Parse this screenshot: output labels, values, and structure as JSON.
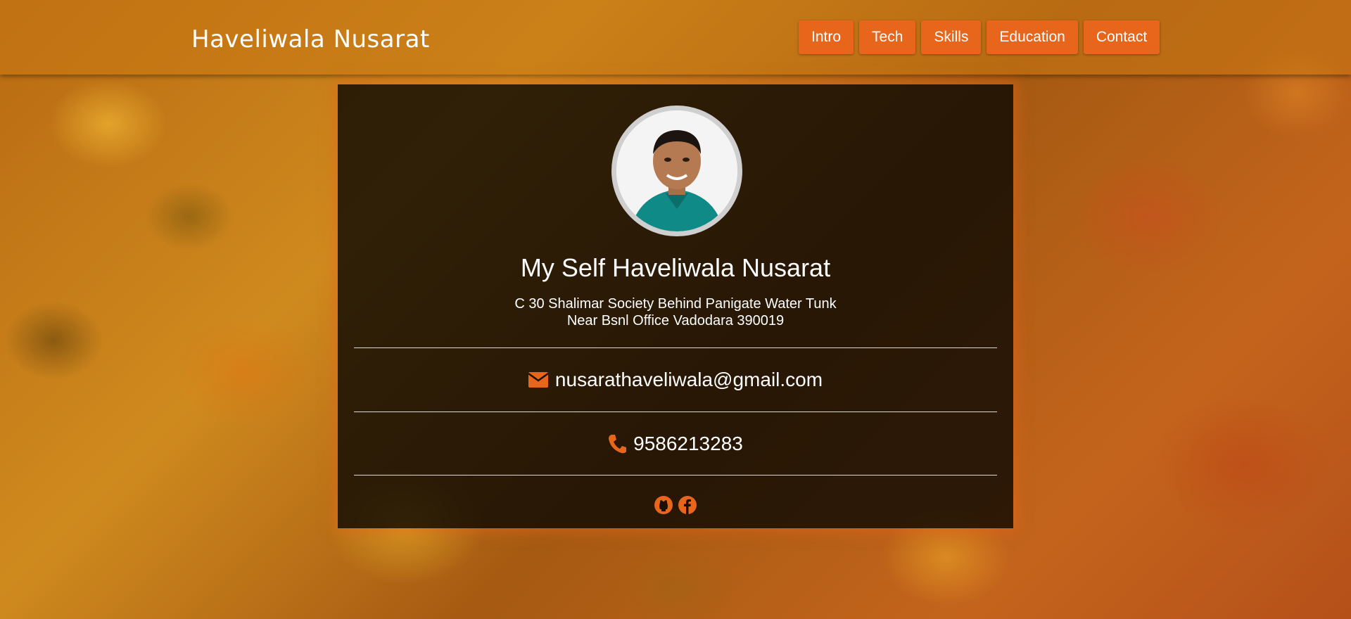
{
  "header": {
    "brand": "Haveliwala Nusarat",
    "nav": [
      {
        "label": "Intro"
      },
      {
        "label": "Tech"
      },
      {
        "label": "Skills"
      },
      {
        "label": "Education"
      },
      {
        "label": "Contact"
      }
    ]
  },
  "profile": {
    "avatar_icon": "profile-photo",
    "name": "My Self Haveliwala Nusarat",
    "address_line1": "C 30 Shalimar Society Behind Panigate Water Tunk",
    "address_line2": "Near Bsnl Office Vadodara 390019",
    "email": "nusarathaveliwala@gmail.com",
    "phone": "9586213283",
    "socials": [
      "github-icon",
      "facebook-icon"
    ]
  },
  "colors": {
    "accent": "#e8651c",
    "card_bg": "#0c0802",
    "text": "#ffffff"
  }
}
